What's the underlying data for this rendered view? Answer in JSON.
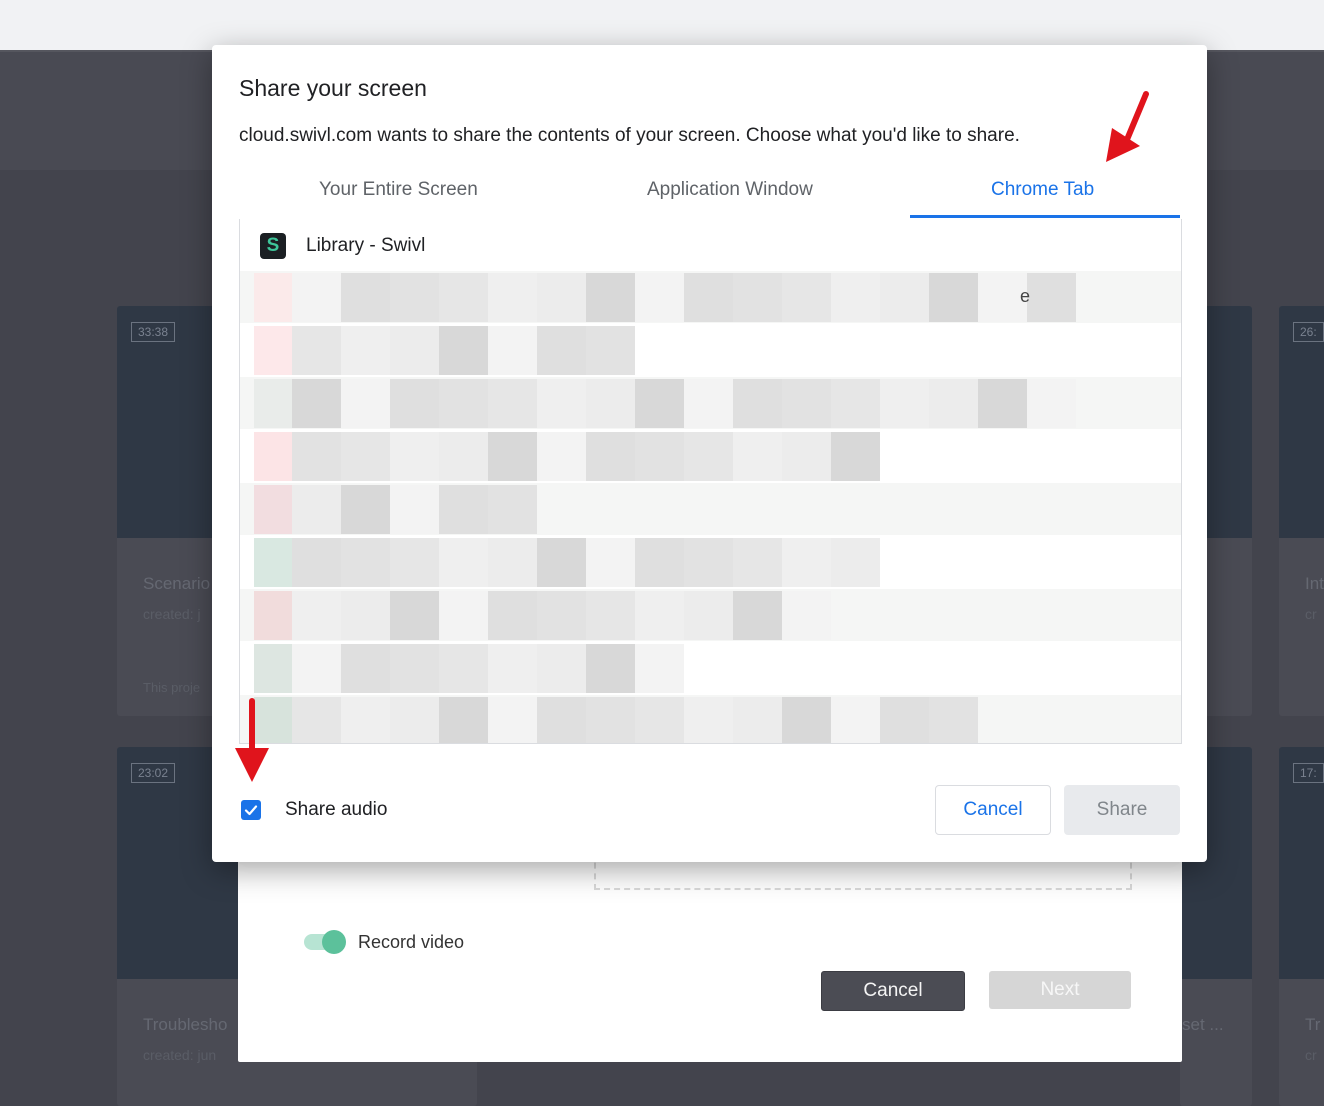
{
  "background": {
    "cards": [
      {
        "duration": "33:38",
        "title": "Scenario",
        "meta": "created: j",
        "footer": "This proje"
      },
      {
        "duration": "26:",
        "title": "Int",
        "meta": "cr",
        "footer": ""
      },
      {
        "duration": "23:02",
        "title": "Troublesho",
        "meta": "created: jun",
        "footer": ""
      },
      {
        "duration": "17:",
        "title": "Tr",
        "meta": "cr",
        "footer": ""
      }
    ],
    "partial_text": "set ..."
  },
  "swivl_modal": {
    "record_video_label": "Record video",
    "cancel_label": "Cancel",
    "next_label": "Next"
  },
  "share_dialog": {
    "title": "Share your screen",
    "description": "cloud.swivl.com wants to share the contents of your screen. Choose what you'd like to share.",
    "tabs": [
      {
        "label": "Your Entire Screen",
        "active": false
      },
      {
        "label": "Application Window",
        "active": false
      },
      {
        "label": "Chrome Tab",
        "active": true
      }
    ],
    "list": {
      "first_item": {
        "icon": "S",
        "title": "Library - Swivl"
      },
      "peek_text": "e"
    },
    "share_audio_label": "Share audio",
    "share_audio_checked": true,
    "cancel_label": "Cancel",
    "share_label": "Share"
  },
  "colors": {
    "accent": "#1a73e8",
    "annotation_arrow": "#e0141c",
    "toggle_on": "#5cc19b"
  }
}
